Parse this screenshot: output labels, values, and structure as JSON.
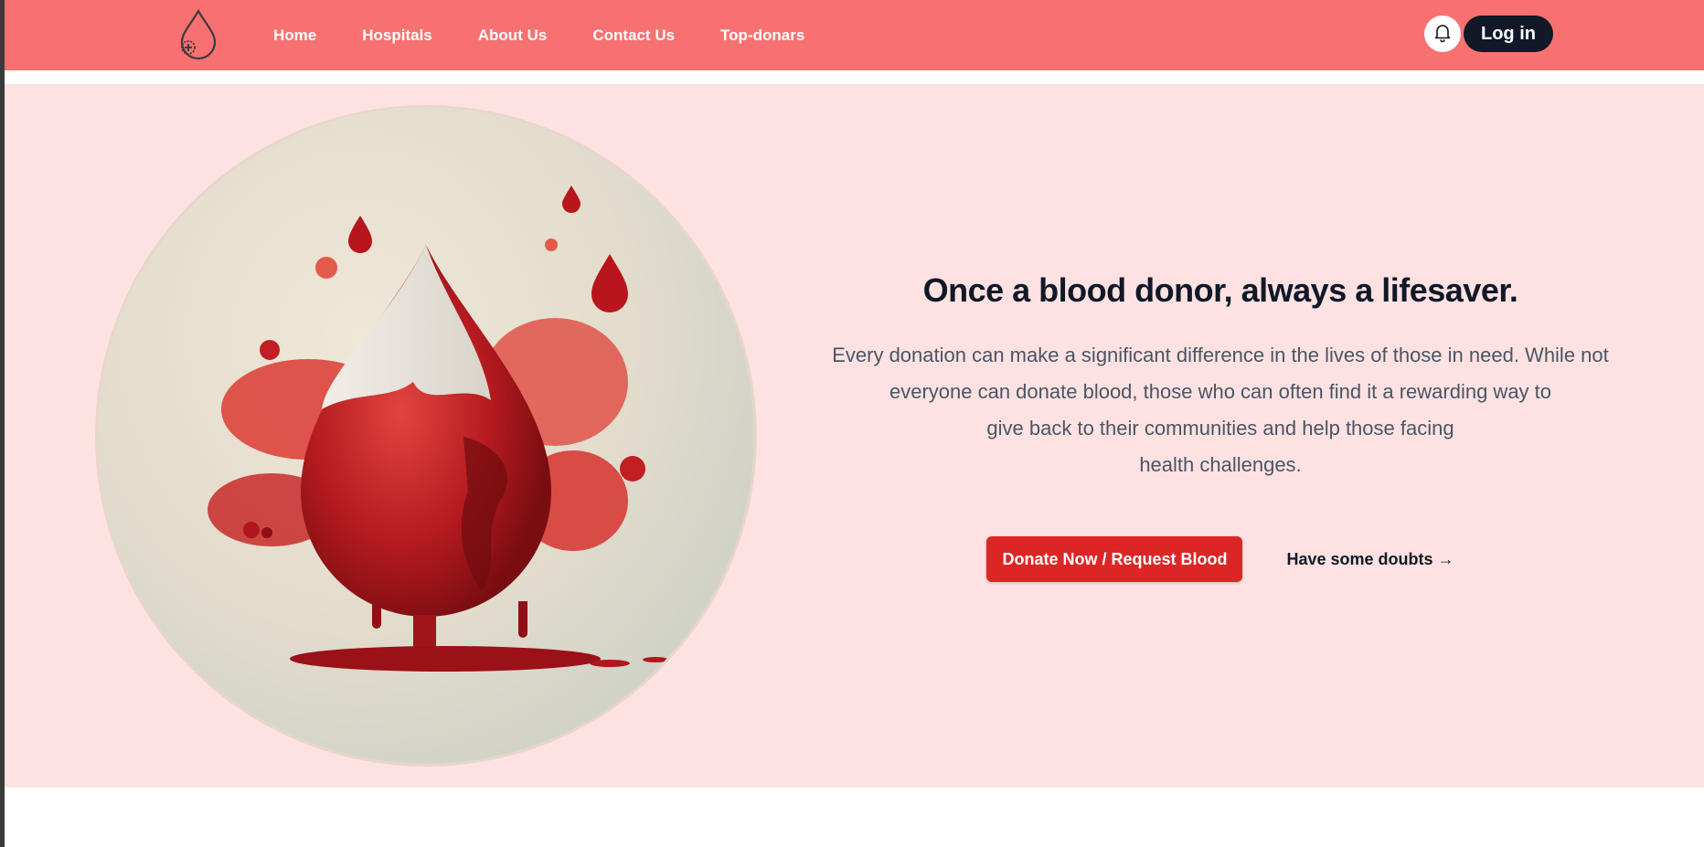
{
  "nav": {
    "logo_icon": "blood-drop-plus-icon",
    "links": [
      "Home",
      "Hospitals",
      "About Us",
      "Contact Us",
      "Top-donars"
    ],
    "bell_icon": "bell-icon",
    "login_label": "Log in"
  },
  "hero": {
    "image_alt": "blood-drop-globe-illustration",
    "title": "Once a blood donor, always a lifesaver.",
    "description_lines": [
      "Every donation can make a significant difference in the lives of those in need. While not",
      "everyone can donate blood, those who can often find it a rewarding way to",
      "give back to their communities and help those facing",
      "health challenges."
    ],
    "primary_button": "Donate Now / Request Blood",
    "secondary_link": "Have some doubts →"
  },
  "colors": {
    "navbar": "#f87171",
    "hero_bg": "#fee2e2",
    "primary": "#dc2626",
    "dark": "#111827"
  }
}
